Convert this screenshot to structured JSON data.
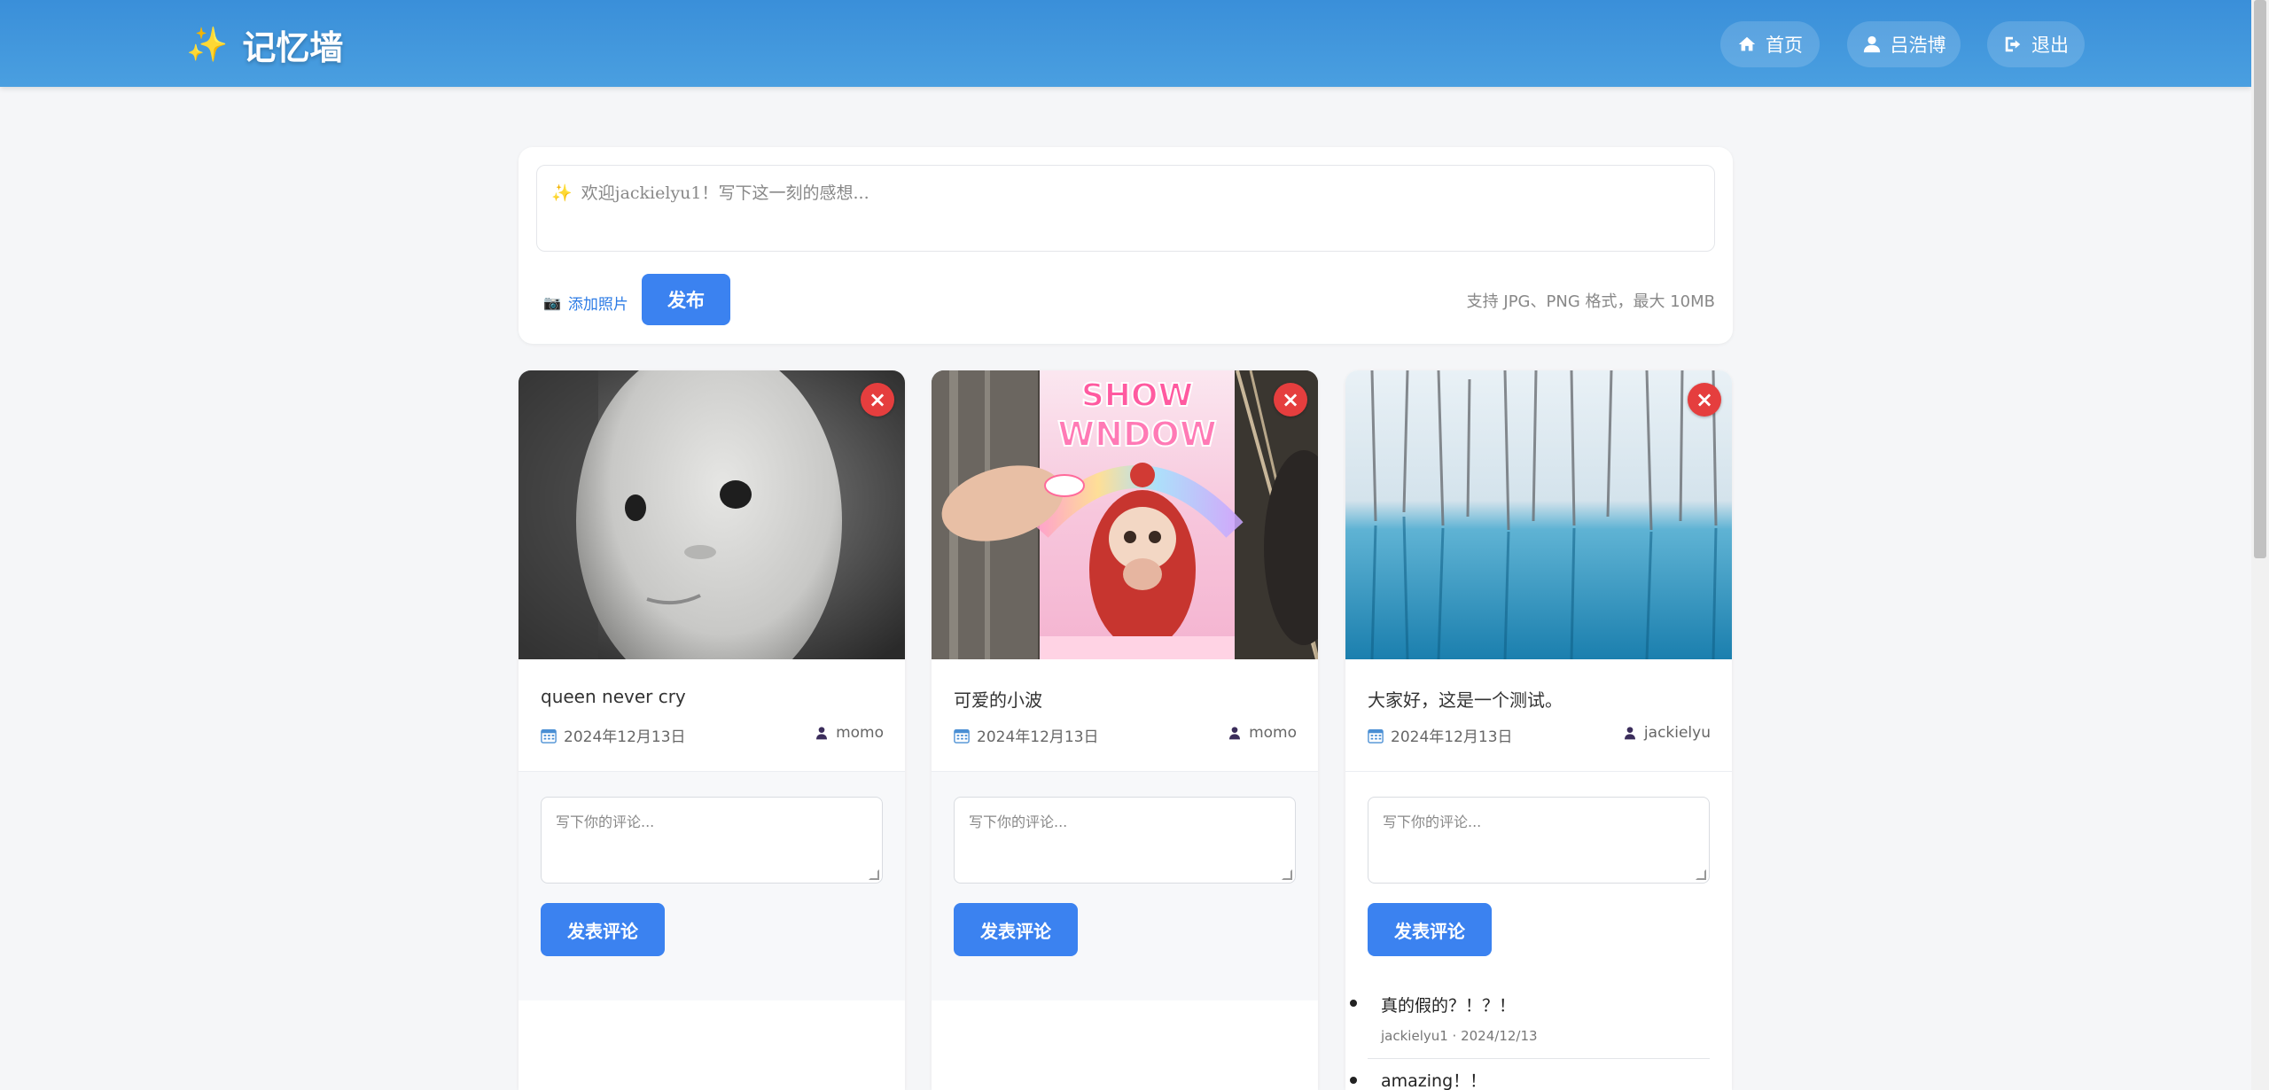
{
  "header": {
    "brand_icon": "✨",
    "brand_title": "记忆墙",
    "nav": [
      {
        "label": "首页",
        "icon": "home-icon"
      },
      {
        "label": "吕浩博",
        "icon": "user-icon"
      },
      {
        "label": "退出",
        "icon": "logout-icon"
      }
    ]
  },
  "composer": {
    "icon": "✨",
    "placeholder": "欢迎jackielyu1！写下这一刻的感想...",
    "add_photo_icon": "📷",
    "add_photo_label": "添加照片",
    "publish_label": "发布",
    "hint": "支持 JPG、PNG 格式，最大 10MB"
  },
  "posts": [
    {
      "image": "white-mask-face",
      "caption": "queen never cry",
      "date": "2024年12月13日",
      "author": "momo",
      "comment_placeholder": "写下你的评论...",
      "comment_button": "发表评论",
      "comments": []
    },
    {
      "image": "show-window-toy-box",
      "caption": "可爱的小波",
      "date": "2024年12月13日",
      "author": "momo",
      "comment_placeholder": "写下你的评论...",
      "comment_button": "发表评论",
      "comments": []
    },
    {
      "image": "blue-pond-trees",
      "caption": "大家好，这是一个测试。",
      "date": "2024年12月13日",
      "author": "jackielyu",
      "comment_placeholder": "写下你的评论...",
      "comment_button": "发表评论",
      "comments": [
        {
          "text": "真的假的？！？！",
          "meta": "jackielyu1 · 2024/12/13"
        },
        {
          "text": "amazing！！",
          "meta": ""
        }
      ]
    }
  ],
  "colors": {
    "header": "#3a8fd9",
    "primary": "#3b82f0",
    "delete": "#e53e3e",
    "link": "#2c7be5"
  }
}
